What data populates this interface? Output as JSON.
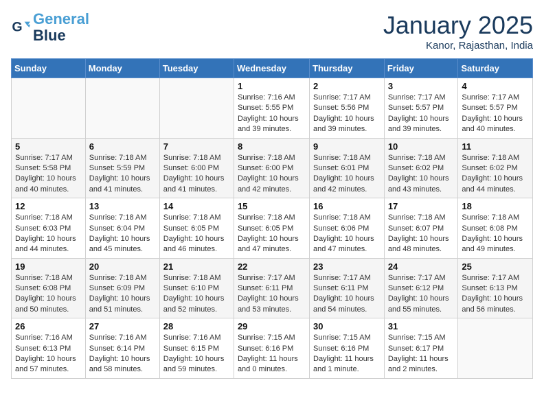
{
  "logo": {
    "line1": "General",
    "line2": "Blue"
  },
  "title": "January 2025",
  "location": "Kanor, Rajasthan, India",
  "days_of_week": [
    "Sunday",
    "Monday",
    "Tuesday",
    "Wednesday",
    "Thursday",
    "Friday",
    "Saturday"
  ],
  "weeks": [
    [
      {
        "num": "",
        "info": ""
      },
      {
        "num": "",
        "info": ""
      },
      {
        "num": "",
        "info": ""
      },
      {
        "num": "1",
        "info": "Sunrise: 7:16 AM\nSunset: 5:55 PM\nDaylight: 10 hours\nand 39 minutes."
      },
      {
        "num": "2",
        "info": "Sunrise: 7:17 AM\nSunset: 5:56 PM\nDaylight: 10 hours\nand 39 minutes."
      },
      {
        "num": "3",
        "info": "Sunrise: 7:17 AM\nSunset: 5:57 PM\nDaylight: 10 hours\nand 39 minutes."
      },
      {
        "num": "4",
        "info": "Sunrise: 7:17 AM\nSunset: 5:57 PM\nDaylight: 10 hours\nand 40 minutes."
      }
    ],
    [
      {
        "num": "5",
        "info": "Sunrise: 7:17 AM\nSunset: 5:58 PM\nDaylight: 10 hours\nand 40 minutes."
      },
      {
        "num": "6",
        "info": "Sunrise: 7:18 AM\nSunset: 5:59 PM\nDaylight: 10 hours\nand 41 minutes."
      },
      {
        "num": "7",
        "info": "Sunrise: 7:18 AM\nSunset: 6:00 PM\nDaylight: 10 hours\nand 41 minutes."
      },
      {
        "num": "8",
        "info": "Sunrise: 7:18 AM\nSunset: 6:00 PM\nDaylight: 10 hours\nand 42 minutes."
      },
      {
        "num": "9",
        "info": "Sunrise: 7:18 AM\nSunset: 6:01 PM\nDaylight: 10 hours\nand 42 minutes."
      },
      {
        "num": "10",
        "info": "Sunrise: 7:18 AM\nSunset: 6:02 PM\nDaylight: 10 hours\nand 43 minutes."
      },
      {
        "num": "11",
        "info": "Sunrise: 7:18 AM\nSunset: 6:02 PM\nDaylight: 10 hours\nand 44 minutes."
      }
    ],
    [
      {
        "num": "12",
        "info": "Sunrise: 7:18 AM\nSunset: 6:03 PM\nDaylight: 10 hours\nand 44 minutes."
      },
      {
        "num": "13",
        "info": "Sunrise: 7:18 AM\nSunset: 6:04 PM\nDaylight: 10 hours\nand 45 minutes."
      },
      {
        "num": "14",
        "info": "Sunrise: 7:18 AM\nSunset: 6:05 PM\nDaylight: 10 hours\nand 46 minutes."
      },
      {
        "num": "15",
        "info": "Sunrise: 7:18 AM\nSunset: 6:05 PM\nDaylight: 10 hours\nand 47 minutes."
      },
      {
        "num": "16",
        "info": "Sunrise: 7:18 AM\nSunset: 6:06 PM\nDaylight: 10 hours\nand 47 minutes."
      },
      {
        "num": "17",
        "info": "Sunrise: 7:18 AM\nSunset: 6:07 PM\nDaylight: 10 hours\nand 48 minutes."
      },
      {
        "num": "18",
        "info": "Sunrise: 7:18 AM\nSunset: 6:08 PM\nDaylight: 10 hours\nand 49 minutes."
      }
    ],
    [
      {
        "num": "19",
        "info": "Sunrise: 7:18 AM\nSunset: 6:08 PM\nDaylight: 10 hours\nand 50 minutes."
      },
      {
        "num": "20",
        "info": "Sunrise: 7:18 AM\nSunset: 6:09 PM\nDaylight: 10 hours\nand 51 minutes."
      },
      {
        "num": "21",
        "info": "Sunrise: 7:18 AM\nSunset: 6:10 PM\nDaylight: 10 hours\nand 52 minutes."
      },
      {
        "num": "22",
        "info": "Sunrise: 7:17 AM\nSunset: 6:11 PM\nDaylight: 10 hours\nand 53 minutes."
      },
      {
        "num": "23",
        "info": "Sunrise: 7:17 AM\nSunset: 6:11 PM\nDaylight: 10 hours\nand 54 minutes."
      },
      {
        "num": "24",
        "info": "Sunrise: 7:17 AM\nSunset: 6:12 PM\nDaylight: 10 hours\nand 55 minutes."
      },
      {
        "num": "25",
        "info": "Sunrise: 7:17 AM\nSunset: 6:13 PM\nDaylight: 10 hours\nand 56 minutes."
      }
    ],
    [
      {
        "num": "26",
        "info": "Sunrise: 7:16 AM\nSunset: 6:13 PM\nDaylight: 10 hours\nand 57 minutes."
      },
      {
        "num": "27",
        "info": "Sunrise: 7:16 AM\nSunset: 6:14 PM\nDaylight: 10 hours\nand 58 minutes."
      },
      {
        "num": "28",
        "info": "Sunrise: 7:16 AM\nSunset: 6:15 PM\nDaylight: 10 hours\nand 59 minutes."
      },
      {
        "num": "29",
        "info": "Sunrise: 7:15 AM\nSunset: 6:16 PM\nDaylight: 11 hours\nand 0 minutes."
      },
      {
        "num": "30",
        "info": "Sunrise: 7:15 AM\nSunset: 6:16 PM\nDaylight: 11 hours\nand 1 minute."
      },
      {
        "num": "31",
        "info": "Sunrise: 7:15 AM\nSunset: 6:17 PM\nDaylight: 11 hours\nand 2 minutes."
      },
      {
        "num": "",
        "info": ""
      }
    ]
  ]
}
